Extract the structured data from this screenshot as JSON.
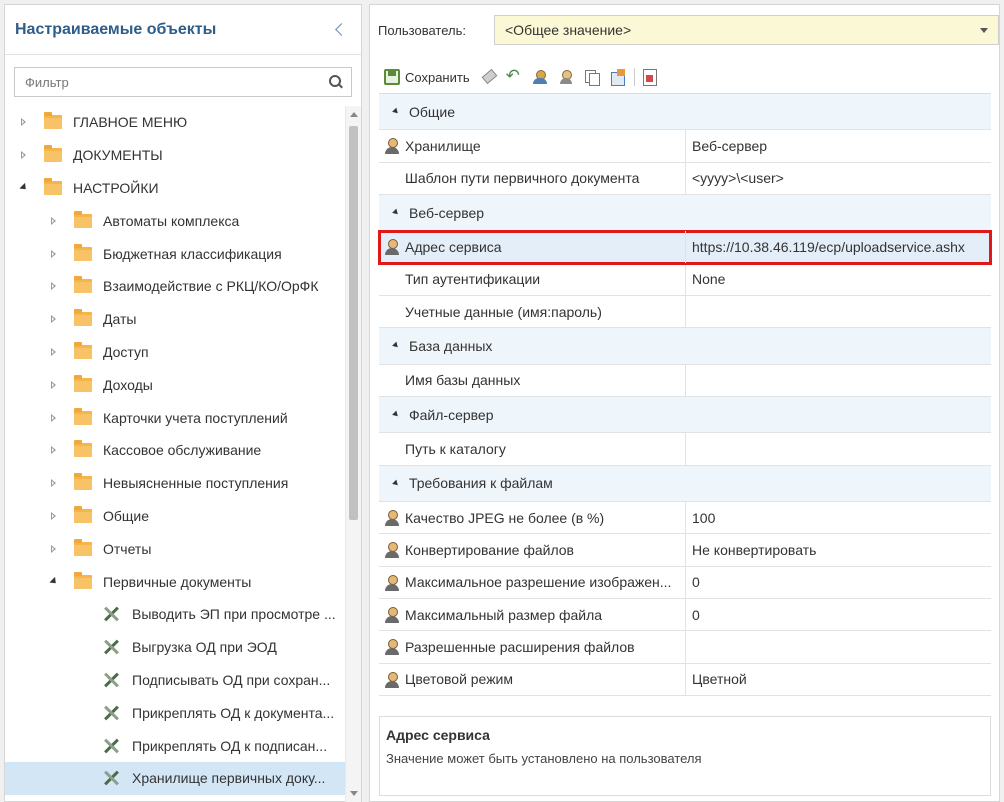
{
  "left_panel": {
    "title": "Настраиваемые объекты",
    "filter_placeholder": "Фильтр",
    "tree": [
      {
        "label": "ГЛАВНОЕ МЕНЮ",
        "level": 0,
        "type": "folder",
        "state": "collapsed"
      },
      {
        "label": "ДОКУМЕНТЫ",
        "level": 0,
        "type": "folder",
        "state": "collapsed"
      },
      {
        "label": "НАСТРОЙКИ",
        "level": 0,
        "type": "folder",
        "state": "expanded"
      },
      {
        "label": "Автоматы комплекса",
        "level": 1,
        "type": "folder",
        "state": "collapsed"
      },
      {
        "label": "Бюджетная классификация",
        "level": 1,
        "type": "folder",
        "state": "collapsed"
      },
      {
        "label": "Взаимодействие с РКЦ/КО/ОрФК",
        "level": 1,
        "type": "folder",
        "state": "collapsed"
      },
      {
        "label": "Даты",
        "level": 1,
        "type": "folder",
        "state": "collapsed"
      },
      {
        "label": "Доступ",
        "level": 1,
        "type": "folder",
        "state": "collapsed"
      },
      {
        "label": "Доходы",
        "level": 1,
        "type": "folder",
        "state": "collapsed"
      },
      {
        "label": "Карточки учета поступлений",
        "level": 1,
        "type": "folder",
        "state": "collapsed"
      },
      {
        "label": "Кассовое обслуживание",
        "level": 1,
        "type": "folder",
        "state": "collapsed"
      },
      {
        "label": "Невыясненные поступления",
        "level": 1,
        "type": "folder",
        "state": "collapsed"
      },
      {
        "label": "Общие",
        "level": 1,
        "type": "folder",
        "state": "collapsed"
      },
      {
        "label": "Отчеты",
        "level": 1,
        "type": "folder",
        "state": "collapsed"
      },
      {
        "label": "Первичные документы",
        "level": 1,
        "type": "folder",
        "state": "expanded"
      },
      {
        "label": "Выводить ЭП при просмотре ...",
        "level": 2,
        "type": "setting",
        "state": "leaf"
      },
      {
        "label": "Выгрузка ОД при ЭОД",
        "level": 2,
        "type": "setting",
        "state": "leaf"
      },
      {
        "label": "Подписывать ОД при сохран...",
        "level": 2,
        "type": "setting",
        "state": "leaf"
      },
      {
        "label": "Прикреплять ОД к документа...",
        "level": 2,
        "type": "setting",
        "state": "leaf"
      },
      {
        "label": "Прикреплять ОД к подписан...",
        "level": 2,
        "type": "setting",
        "state": "leaf"
      },
      {
        "label": "Хранилище первичных доку...",
        "level": 2,
        "type": "setting",
        "state": "leaf",
        "selected": true
      }
    ]
  },
  "right_panel": {
    "user_label": "Пользователь:",
    "user_value": "<Общее значение>",
    "toolbar": {
      "save_label": "Сохранить",
      "icons": [
        "save-icon",
        "eraser-icon",
        "undo-icon",
        "users-icon",
        "user-icon",
        "copy-icon",
        "export-icon",
        "report-icon"
      ]
    },
    "groups": [
      {
        "title": "Общие",
        "rows": [
          {
            "name": "Хранилище",
            "value": "Веб-сервер",
            "user_icon": true
          },
          {
            "name": "Шаблон пути первичного документа",
            "value": "<yyyy>\\<user>",
            "user_icon": false
          }
        ]
      },
      {
        "title": "Веб-сервер",
        "rows": [
          {
            "name": "Адрес сервиса",
            "value": "https://10.38.46.119/ecp/uploadservice.ashx",
            "user_icon": true,
            "highlight": true
          },
          {
            "name": "Тип аутентификации",
            "value": "None",
            "user_icon": false
          },
          {
            "name": "Учетные данные (имя:пароль)",
            "value": "",
            "user_icon": false
          }
        ]
      },
      {
        "title": "База данных",
        "rows": [
          {
            "name": "Имя базы данных",
            "value": "",
            "user_icon": false
          }
        ]
      },
      {
        "title": "Файл-сервер",
        "rows": [
          {
            "name": "Путь к каталогу",
            "value": "",
            "user_icon": false
          }
        ]
      },
      {
        "title": "Требования к файлам",
        "rows": [
          {
            "name": "Качество JPEG не более (в %)",
            "value": "100",
            "user_icon": true
          },
          {
            "name": "Конвертирование файлов",
            "value": "Не конвертировать",
            "user_icon": true
          },
          {
            "name": "Максимальное разрешение изображен...",
            "value": "0",
            "user_icon": true
          },
          {
            "name": "Максимальный размер файла",
            "value": "0",
            "user_icon": true
          },
          {
            "name": "Разрешенные расширения файлов",
            "value": "",
            "user_icon": true
          },
          {
            "name": "Цветовой режим",
            "value": "Цветной",
            "user_icon": true
          }
        ]
      }
    ],
    "description": {
      "title": "Адрес сервиса",
      "text": "Значение может быть установлено на пользователя"
    }
  },
  "colors": {
    "title": "#2e5d8a",
    "selection": "#d3e6f6",
    "group_bg": "#eef5fb",
    "highlight_border": "#e01818",
    "user_select_bg": "#fbf8d6"
  }
}
